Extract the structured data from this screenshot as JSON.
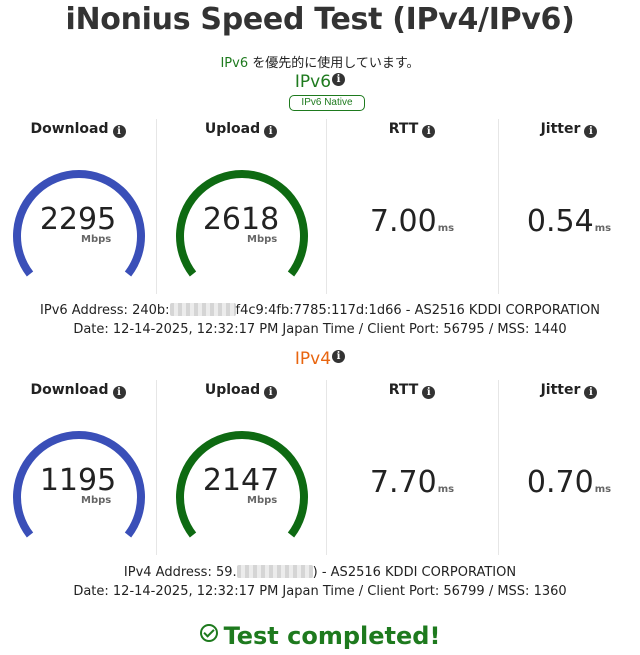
{
  "title": "iNonius Speed Test (IPv4/IPv6)",
  "preference": {
    "proto": "IPv6",
    "text": " を優先的に使用しています。"
  },
  "ipv6": {
    "heading": "IPv6",
    "badge": "IPv6 Native",
    "download_label": "Download",
    "upload_label": "Upload",
    "rtt_label": "RTT",
    "jitter_label": "Jitter",
    "download_value": "2295",
    "upload_value": "2618",
    "rtt_value": "7.00",
    "jitter_value": "0.54",
    "address_prefix": "IPv6 Address: 240b:",
    "address_suffix": "f4c9:4fb:7785:117d:1d66 - AS2516 KDDI CORPORATION",
    "date_line": "Date: 12-14-2025, 12:32:17 PM Japan Time / Client Port: 56795 / MSS: 1440"
  },
  "ipv4": {
    "heading": "IPv4",
    "download_label": "Download",
    "upload_label": "Upload",
    "rtt_label": "RTT",
    "jitter_label": "Jitter",
    "download_value": "1195",
    "upload_value": "2147",
    "rtt_value": "7.70",
    "jitter_value": "0.70",
    "address_prefix": "IPv4 Address: 59.",
    "address_suffix": ") - AS2516 KDDI CORPORATION",
    "date_line": "Date: 12-14-2025, 12:32:17 PM Japan Time / Client Port: 56799 / MSS: 1360"
  },
  "units": {
    "speed": "Mbps",
    "time": "ms"
  },
  "info_glyph": "i",
  "status": "Test completed!",
  "colors": {
    "download_arc": "#3a4fb8",
    "upload_arc": "#0e6a12",
    "ipv6_accent": "#1e7a1e",
    "ipv4_accent": "#e8650f",
    "success": "#1e7a1e"
  }
}
